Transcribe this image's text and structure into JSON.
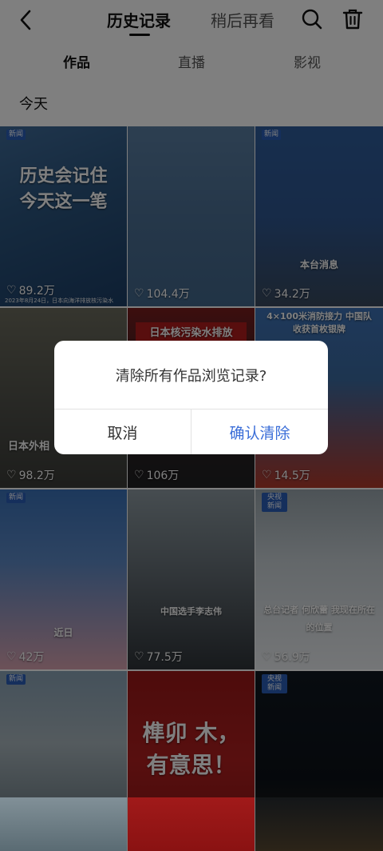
{
  "header": {
    "tab_history": "历史记录",
    "tab_later": "稍后再看"
  },
  "subtabs": [
    "作品",
    "直播",
    "影视"
  ],
  "section_title": "今天",
  "tiles": [
    {
      "badge": "新闻",
      "caption": "历史会记住 今天这一笔",
      "likes": "89.2万",
      "sub": "2023年8月24日，日本向海洋排放核污染水"
    },
    {
      "badge": "",
      "caption": "",
      "likes": "104.4万",
      "sub": ""
    },
    {
      "badge": "新闻",
      "caption": "本台消息",
      "likes": "34.2万",
      "sub": ""
    },
    {
      "badge": "",
      "caption": "日本外相",
      "likes": "98.2万",
      "sub": ""
    },
    {
      "badge": "",
      "caption": "日本核污染水排放",
      "likes": "106万",
      "sub": ""
    },
    {
      "badge": "",
      "caption": "4×100米消防接力 中国队收获首枚银牌",
      "likes": "14.5万",
      "sub": ""
    },
    {
      "badge": "新闻",
      "caption": "近日",
      "likes": "42万",
      "sub": ""
    },
    {
      "badge": "",
      "caption": "中国选手李志伟",
      "likes": "77.5万",
      "sub": ""
    },
    {
      "badge": "央视新闻",
      "caption": "总台记者 何欣蕾 我现在所在的位置",
      "likes": "56.9万",
      "sub": ""
    },
    {
      "badge": "新闻",
      "caption": "",
      "likes": "",
      "sub": ""
    },
    {
      "badge": "",
      "caption": "榫卯 木，有意思！",
      "likes": "",
      "sub": ""
    },
    {
      "badge": "央视新闻",
      "caption": "",
      "likes": "",
      "sub": ""
    }
  ],
  "dialog": {
    "message": "清除所有作品浏览记录?",
    "cancel": "取消",
    "confirm": "确认清除"
  }
}
